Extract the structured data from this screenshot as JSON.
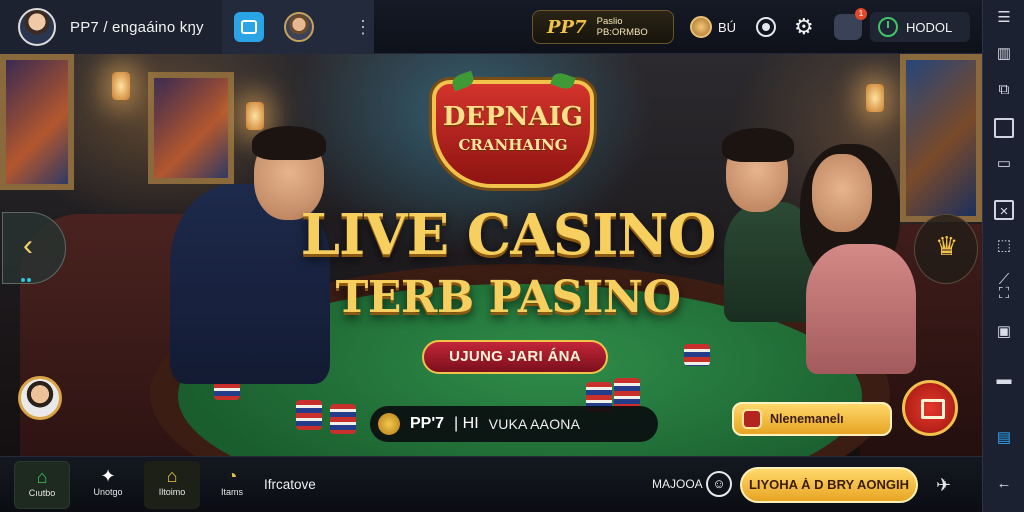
{
  "topbar": {
    "title": "PP7 / engaáino kŋy",
    "brand_logo": "PP7",
    "brand_sub_line1": "Paslio",
    "brand_sub_line2": "PB:ORMBO",
    "coin_label": "BÚ",
    "home_label": "HODOL",
    "notification_count": "1"
  },
  "banner": {
    "emblem_line1": "DEPNAIG",
    "emblem_line2": "CRANHAING",
    "headline1": "LIVE CASINO",
    "headline2": "TERB PASINO",
    "promo": "UJUNG JARI ÁNA",
    "info_brand": "PP'7",
    "info_sep": "| HI",
    "info_text": "VUKA AAONA",
    "cta_label": "Nlenemanelı"
  },
  "bottombar": {
    "tabs": [
      {
        "label": "Cıutbo",
        "icon": "home-icon"
      },
      {
        "label": "Unotgo",
        "icon": "sparkle-icon"
      },
      {
        "label": "Iltoimo",
        "icon": "shop-icon"
      },
      {
        "label": "Itams",
        "icon": "timer-icon"
      }
    ],
    "text": "Ifrcatove",
    "user": "MAJOOA",
    "cta_wide": "LIYOHA Ȧ D BRY AONGIH"
  },
  "sidebar": {
    "icons": [
      "menu-icon",
      "layout-icon",
      "square-icon",
      "expand-icon",
      "frame-icon",
      "trend-icon",
      "crop-icon",
      "layers-icon",
      "keyboard-icon",
      "screen-icon",
      "back-icon"
    ]
  },
  "colors": {
    "gold": "#f6cf5e",
    "accent_red": "#c3263a",
    "felt_green": "#2f8d4a",
    "sidebar_active": "#2ea6ef"
  }
}
